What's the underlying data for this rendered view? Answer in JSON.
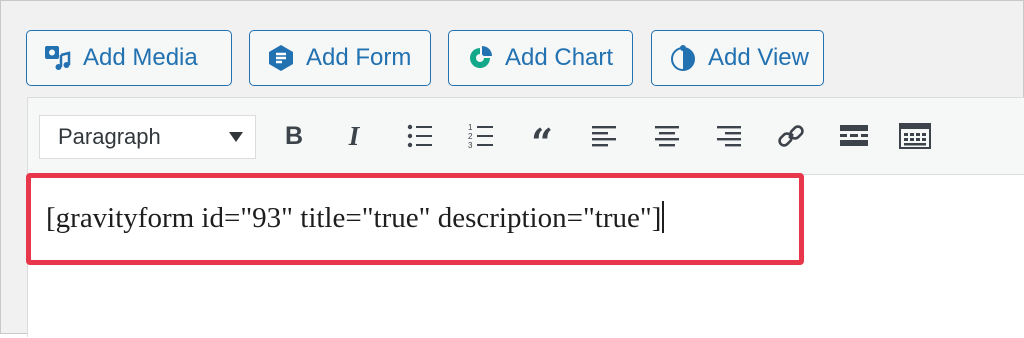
{
  "media_buttons": [
    {
      "label": "Add Media",
      "icon": "media-icon"
    },
    {
      "label": "Add Form",
      "icon": "gravity-forms-icon"
    },
    {
      "label": "Add Chart",
      "icon": "chart-icon"
    },
    {
      "label": "Add View",
      "icon": "gravityview-icon"
    }
  ],
  "toolbar": {
    "format_select": "Paragraph",
    "buttons": [
      "bold",
      "italic",
      "bulleted-list",
      "numbered-list",
      "blockquote",
      "align-left",
      "align-center",
      "align-right",
      "insert-link",
      "read-more",
      "toolbar-toggle"
    ]
  },
  "editor": {
    "content": "[gravityform id=\"93\" title=\"true\" description=\"true\"]"
  },
  "colors": {
    "accent": "#2271b1",
    "highlight": "#e8364a"
  }
}
